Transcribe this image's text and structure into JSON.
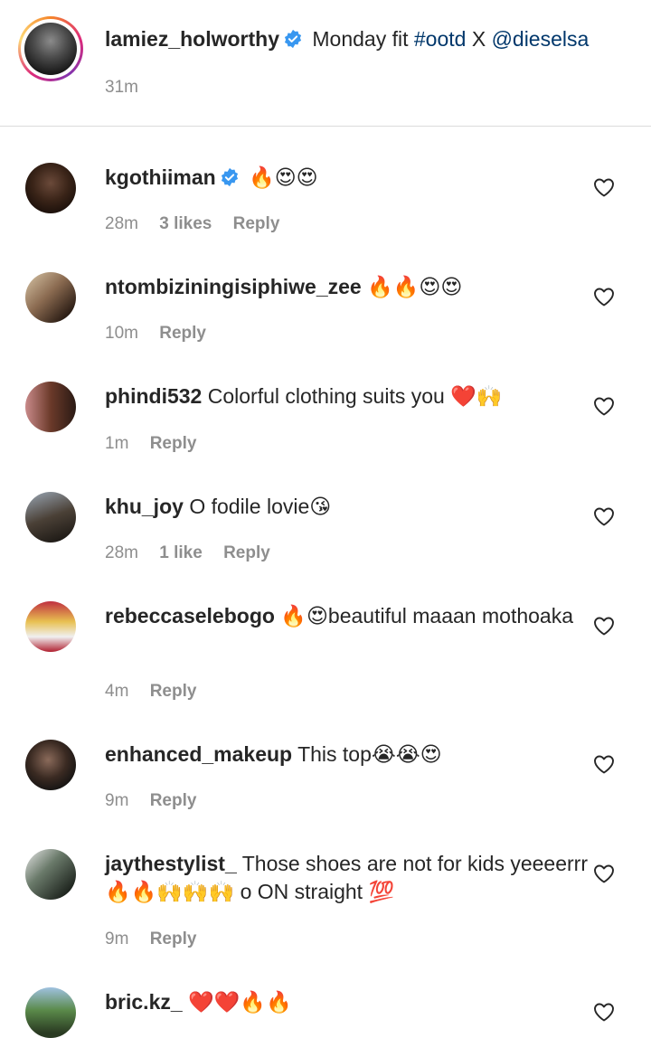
{
  "caption": {
    "username": "lamiez_holworthy",
    "text": "Monday fit",
    "hashtag": "#ootd",
    "connector": "X",
    "mention": "@dieselsa",
    "time": "31m"
  },
  "comments": [
    {
      "username": "kgothiiman",
      "text": "🔥😍😍",
      "time": "28m",
      "likes": "3 likes",
      "reply": "Reply",
      "verified": true
    },
    {
      "username": "ntombiziningisiphiwe_zee",
      "text": "🔥🔥😍😍",
      "time": "10m",
      "likes": "",
      "reply": "Reply"
    },
    {
      "username": "phindi532",
      "text": "Colorful clothing suits you ❤️🙌",
      "time": "1m",
      "likes": "",
      "reply": "Reply"
    },
    {
      "username": "khu_joy",
      "text": "O fodile lovie😘",
      "time": "28m",
      "likes": "1 like",
      "reply": "Reply"
    },
    {
      "username": "rebeccaselebogo",
      "text": "🔥😍beautiful maaan mothoaka",
      "time": "4m",
      "likes": "",
      "reply": "Reply"
    },
    {
      "username": "enhanced_makeup",
      "text": "This top😭😭😍",
      "time": "9m",
      "likes": "",
      "reply": "Reply"
    },
    {
      "username": "jaythestylist_",
      "text": "Those shoes are not for kids yeeeerrr🔥🔥🙌🙌🙌 o ON straight 💯",
      "time": "9m",
      "likes": "",
      "reply": "Reply"
    },
    {
      "username": "bric.kz_",
      "text": "❤️❤️🔥🔥",
      "time": "",
      "likes": "",
      "reply": ""
    }
  ],
  "icons": {
    "verified": "verified-badge-icon",
    "heart": "heart-outline-icon"
  },
  "colors": {
    "verified": "#3897f0",
    "link": "#00376b",
    "muted": "#8e8e8e",
    "divider": "#dbdbdb"
  }
}
